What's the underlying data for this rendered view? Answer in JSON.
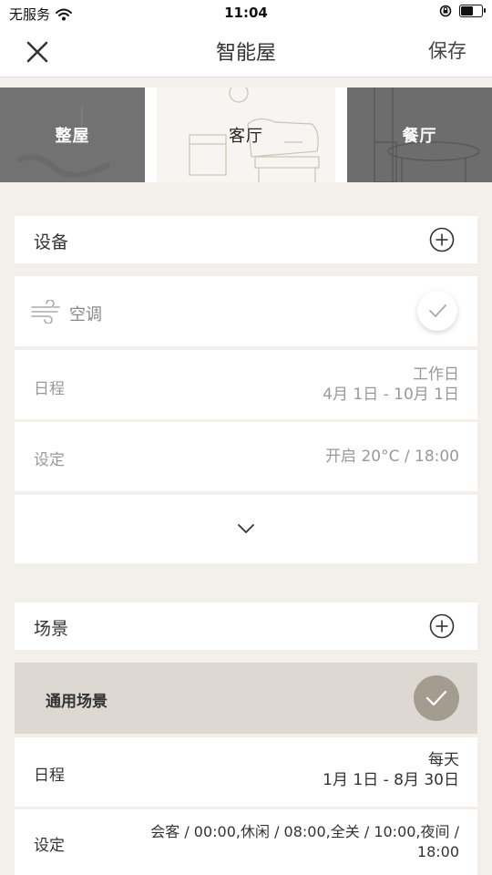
{
  "status": {
    "carrier": "无服务",
    "time": "11:04"
  },
  "nav": {
    "title": "智能屋",
    "save": "保存"
  },
  "rooms": [
    "整屋",
    "客厅",
    "餐厅"
  ],
  "devices": {
    "title": "设备",
    "item": {
      "name": "空调",
      "icon": "ac-wind-icon"
    },
    "schedule_label": "日程",
    "schedule_line1": "工作日",
    "schedule_line2": "4月 1日 - 10月 1日",
    "setting_label": "设定",
    "setting_value": "开启 20°C / 18:00"
  },
  "scenes": {
    "title": "场景",
    "item": {
      "name": "通用场景"
    },
    "schedule_label": "日程",
    "schedule_line1": "每天",
    "schedule_line2": "1月 1日 - 8月 30日",
    "setting_label": "设定",
    "setting_line1": "会客 / 00:00,休闲 / 08:00,全关 / 10:00,夜间 /",
    "setting_line2": "18:00"
  }
}
